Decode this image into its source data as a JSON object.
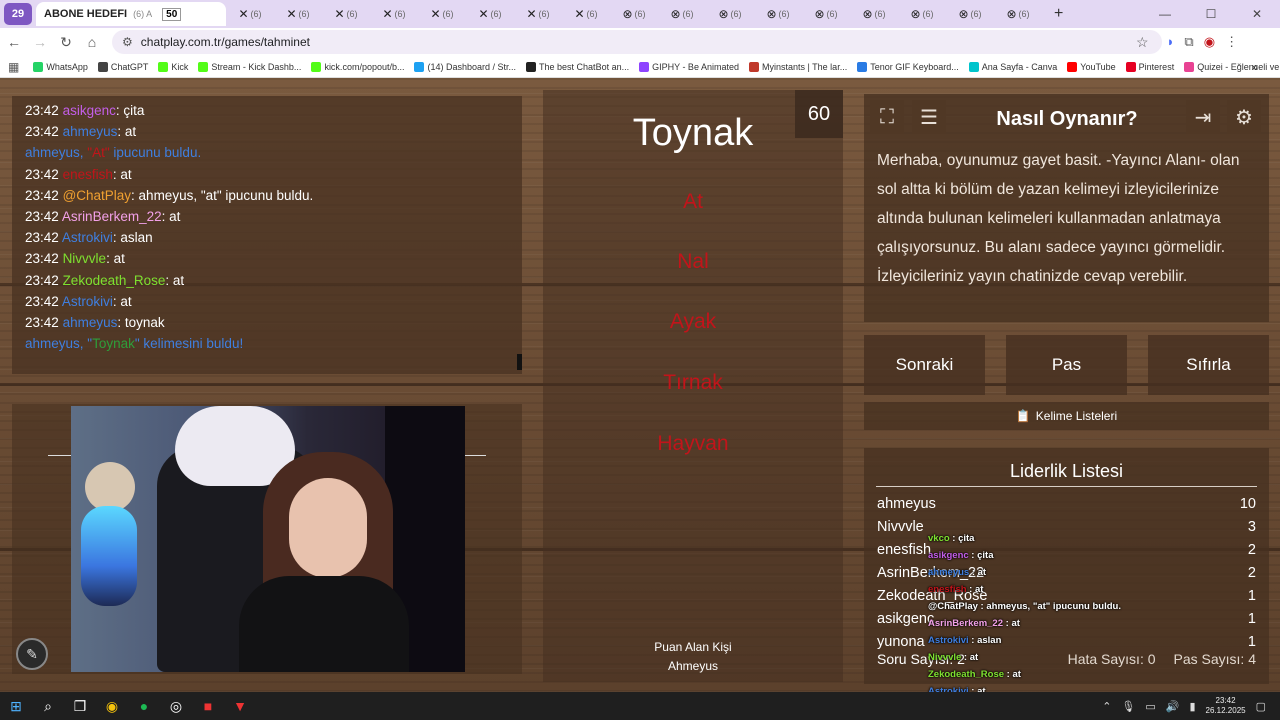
{
  "browser": {
    "tab_count": "29",
    "active_tab_title": "ABONE HEDEFI",
    "active_tab_sub": "(6) A",
    "active_tab_badge": "50",
    "mini_tab_label": "(6)",
    "mini_tab_count": 17,
    "url": "chatplay.com.tr/games/tahminet",
    "bookmarks": [
      {
        "label": "WhatsApp",
        "color": "#25d366"
      },
      {
        "label": "ChatGPT",
        "color": "#444444"
      },
      {
        "label": "Kick",
        "color": "#53fc18"
      },
      {
        "label": "Stream - Kick Dashb...",
        "color": "#53fc18"
      },
      {
        "label": "kick.com/popout/b...",
        "color": "#53fc18"
      },
      {
        "label": "(14) Dashboard / Str...",
        "color": "#1da1f2"
      },
      {
        "label": "The best ChatBot an...",
        "color": "#222222"
      },
      {
        "label": "GIPHY - Be Animated",
        "color": "#8e44ff"
      },
      {
        "label": "Myinstants | The lar...",
        "color": "#c0392b"
      },
      {
        "label": "Tenor GIF Keyboard...",
        "color": "#2a7be4"
      },
      {
        "label": "Ana Sayfa - Canva",
        "color": "#00c4cc"
      },
      {
        "label": "YouTube",
        "color": "#ff0000"
      },
      {
        "label": "Pinterest",
        "color": "#e60023"
      },
      {
        "label": "Quizei - Eğlenceli ve...",
        "color": "#e84393"
      }
    ]
  },
  "chat": [
    {
      "time": "23:42",
      "user": "asikgenc",
      "color": "#c35ee8",
      "msg": ": çita"
    },
    {
      "time": "23:42",
      "user": "ahmeyus",
      "color": "#3f7fe0",
      "msg": ": at"
    },
    {
      "system_parts": [
        {
          "text": "ahmeyus, ",
          "color": "#3f7fe0"
        },
        {
          "text": "\"At\"",
          "color": "#c2141a"
        },
        {
          "text": " ipucunu buldu.",
          "color": "#3f7fe0"
        }
      ]
    },
    {
      "time": "23:42",
      "user": "enesfish",
      "color": "#c2141a",
      "msg": ": at"
    },
    {
      "time": "23:42",
      "user": "@ChatPlay",
      "color": "#f0a030",
      "msg": ": ahmeyus, \"at\" ipucunu buldu."
    },
    {
      "time": "23:42",
      "user": "AsrinBerkem_22",
      "color": "#f2a0e8",
      "msg": ": at"
    },
    {
      "time": "23:42",
      "user": "Astrokivi",
      "color": "#3f7fe0",
      "msg": ": aslan"
    },
    {
      "time": "23:42",
      "user": "Nivvvle",
      "color": "#7ee030",
      "msg": ": at"
    },
    {
      "time": "23:42",
      "user": "Zekodeath_Rose",
      "color": "#7ee030",
      "msg": ": at"
    },
    {
      "time": "23:42",
      "user": "Astrokivi",
      "color": "#3f7fe0",
      "msg": ": at"
    },
    {
      "time": "23:42",
      "user": "ahmeyus",
      "color": "#3f7fe0",
      "msg": ": toynak"
    },
    {
      "system_parts": [
        {
          "text": "ahmeyus, \"",
          "color": "#3f7fe0"
        },
        {
          "text": "Toynak",
          "color": "#2e9e3a"
        },
        {
          "text": "\" kelimesini buldu!",
          "color": "#3f7fe0"
        }
      ]
    }
  ],
  "game": {
    "timer": "60",
    "main_word": "Toynak",
    "forbidden_words": [
      "At",
      "Nal",
      "Ayak",
      "Tırnak",
      "Hayvan"
    ],
    "scorer_label": "Puan Alan Kişi",
    "scorer_name": "Ahmeyus"
  },
  "info": {
    "title": "Nasıl Oynanır?",
    "text": "Merhaba, oyunumuz gayet basit. -Yayıncı Alanı- olan sol altta ki bölüm de yazan kelimeyi izleyicilerinize altında bulunan kelimeleri kullanmadan anlatmaya çalışıyorsunuz. Bu alanı sadece yayıncı görmelidir. İzleyicileriniz yayın chatinizde cevap verebilir."
  },
  "controls": {
    "next": "Sonraki",
    "pass": "Pas",
    "reset": "Sıfırla",
    "word_lists": "Kelime Listeleri"
  },
  "leaderboard": {
    "title": "Liderlik Listesi",
    "rows": [
      {
        "name": "ahmeyus",
        "score": "10"
      },
      {
        "name": "Nivvvle",
        "score": "3"
      },
      {
        "name": "enesfish",
        "score": "2"
      },
      {
        "name": "AsrinBerkem_22",
        "score": "2"
      },
      {
        "name": "Zekodeath_Rose",
        "score": "1"
      },
      {
        "name": "asikgenc",
        "score": "1"
      },
      {
        "name": "yunona",
        "score": "1"
      }
    ],
    "question_count_label": "Soru Sayısı: 2",
    "error_count_label": "Hata Sayısı: 0",
    "pass_count_label": "Pas Sayısı: 4"
  },
  "overlay_chat": [
    {
      "user": "vkco",
      "color": "#7ee030",
      "msg": " : çita"
    },
    {
      "user": "asikgenc",
      "color": "#c35ee8",
      "msg": " : çita"
    },
    {
      "user": "ahmeyus",
      "color": "#3f7fe0",
      "msg": " : at"
    },
    {
      "user": "enesfish",
      "color": "#c2141a",
      "msg": " : at"
    },
    {
      "user": "@ChatPlay",
      "color": "#ffffff",
      "msg": " : ahmeyus, \"at\" ipucunu buldu."
    },
    {
      "user": "AsrinBerkem_22",
      "color": "#f2a0e8",
      "msg": " : at"
    },
    {
      "user": "Astrokivi",
      "color": "#3f7fe0",
      "msg": " : aslan"
    },
    {
      "user": "Nivvvle",
      "color": "#7ee030",
      "msg": " : at"
    },
    {
      "user": "Zekodeath_Rose",
      "color": "#7ee030",
      "msg": " : at"
    },
    {
      "user": "Astrokivi",
      "color": "#3f7fe0",
      "msg": " : at"
    }
  ],
  "taskbar": {
    "time": "23:42",
    "date": "26.12.2025"
  }
}
